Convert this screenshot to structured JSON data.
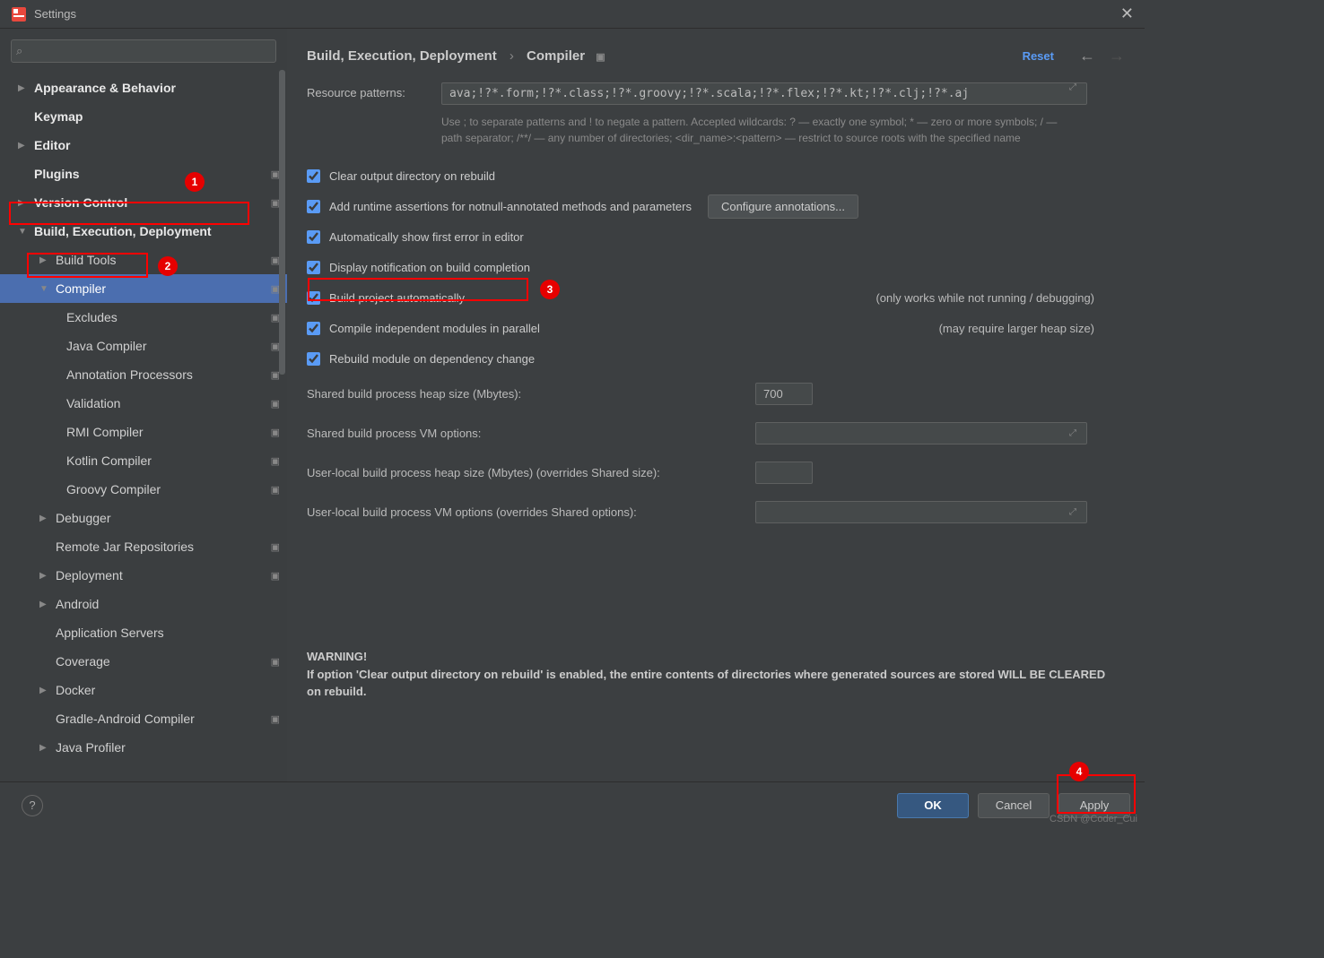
{
  "titlebar": {
    "title": "Settings"
  },
  "search": {
    "placeholder": ""
  },
  "tree": {
    "appearance": "Appearance & Behavior",
    "keymap": "Keymap",
    "editor": "Editor",
    "plugins": "Plugins",
    "vcs": "Version Control",
    "build": "Build, Execution, Deployment",
    "build_tools": "Build Tools",
    "compiler": "Compiler",
    "excludes": "Excludes",
    "java_compiler": "Java Compiler",
    "annotation_proc": "Annotation Processors",
    "validation": "Validation",
    "rmi": "RMI Compiler",
    "kotlin": "Kotlin Compiler",
    "groovy": "Groovy Compiler",
    "debugger": "Debugger",
    "remote_jar": "Remote Jar Repositories",
    "deployment": "Deployment",
    "android": "Android",
    "app_servers": "Application Servers",
    "coverage": "Coverage",
    "docker": "Docker",
    "gradle_android": "Gradle-Android Compiler",
    "java_profiler": "Java Profiler"
  },
  "breadcrumb": {
    "root": "Build, Execution, Deployment",
    "leaf": "Compiler",
    "reset": "Reset"
  },
  "form": {
    "resource_patterns_label": "Resource patterns:",
    "resource_patterns_value": "ava;!?*.form;!?*.class;!?*.groovy;!?*.scala;!?*.flex;!?*.kt;!?*.clj;!?*.aj",
    "help_patterns": "Use ; to separate patterns and ! to negate a pattern. Accepted wildcards: ? — exactly one symbol; * — zero or more symbols; / — path separator; /**/ — any number of directories; <dir_name>:<pattern> — restrict to source roots with the specified name",
    "chk_clear": "Clear output directory on rebuild",
    "chk_notnull": "Add runtime assertions for notnull-annotated methods and parameters",
    "btn_configure": "Configure annotations...",
    "chk_firsterror": "Automatically show first error in editor",
    "chk_displaynotif": "Display notification on build completion",
    "chk_buildauto": "Build project automatically",
    "note_buildauto": "(only works while not running / debugging)",
    "chk_parallel": "Compile independent modules in parallel",
    "note_parallel": "(may require larger heap size)",
    "chk_rebuild_dep": "Rebuild module on dependency change",
    "fld_heap": "Shared build process heap size (Mbytes):",
    "val_heap": "700",
    "fld_vmopts": "Shared build process VM options:",
    "val_vmopts": "",
    "fld_user_heap": "User-local build process heap size (Mbytes) (overrides Shared size):",
    "val_user_heap": "",
    "fld_user_vmopts": "User-local build process VM options (overrides Shared options):",
    "val_user_vmopts": "",
    "warning_title": "WARNING!",
    "warning_body": "If option 'Clear output directory on rebuild' is enabled, the entire contents of directories where generated sources are stored WILL BE CLEARED on rebuild."
  },
  "buttons": {
    "ok": "OK",
    "cancel": "Cancel",
    "apply": "Apply"
  },
  "annotations": {
    "b1": "1",
    "b2": "2",
    "b3": "3",
    "b4": "4"
  },
  "watermark": "CSDN @Coder_Cui"
}
